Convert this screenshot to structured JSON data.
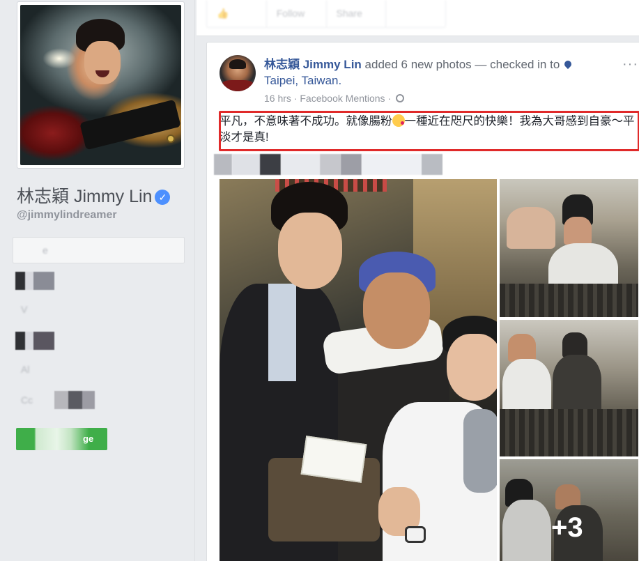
{
  "sidebar": {
    "page_name": "林志穎 Jimmy Lin",
    "verified_icon": "check-icon",
    "handle": "@jimmylindreamer",
    "blurred_field": "e",
    "blurred_items": [
      "V",
      "Al",
      "Cc",
      "ge"
    ],
    "cta_label": "ge",
    "cta_color": "#3fae49"
  },
  "actionbar": {
    "buttons": [
      "",
      "Follow",
      "Share"
    ]
  },
  "post": {
    "author": "林志穎 Jimmy Lin",
    "action": "added 6 new photos — checked in to",
    "location": "Taipei, Taiwan.",
    "time": "16 hrs",
    "source": "Facebook Mentions",
    "separator": "·",
    "more": "···",
    "text_part1": "平凡，不意味著不成功。就像腸粉",
    "text_part2": "一種近在咫尺的快樂！我為大哥感到自豪～平淡才是真!",
    "highlight_color": "#e02a2a",
    "link_color": "#365899"
  },
  "photos": {
    "count": 6,
    "more_label": "+3"
  }
}
